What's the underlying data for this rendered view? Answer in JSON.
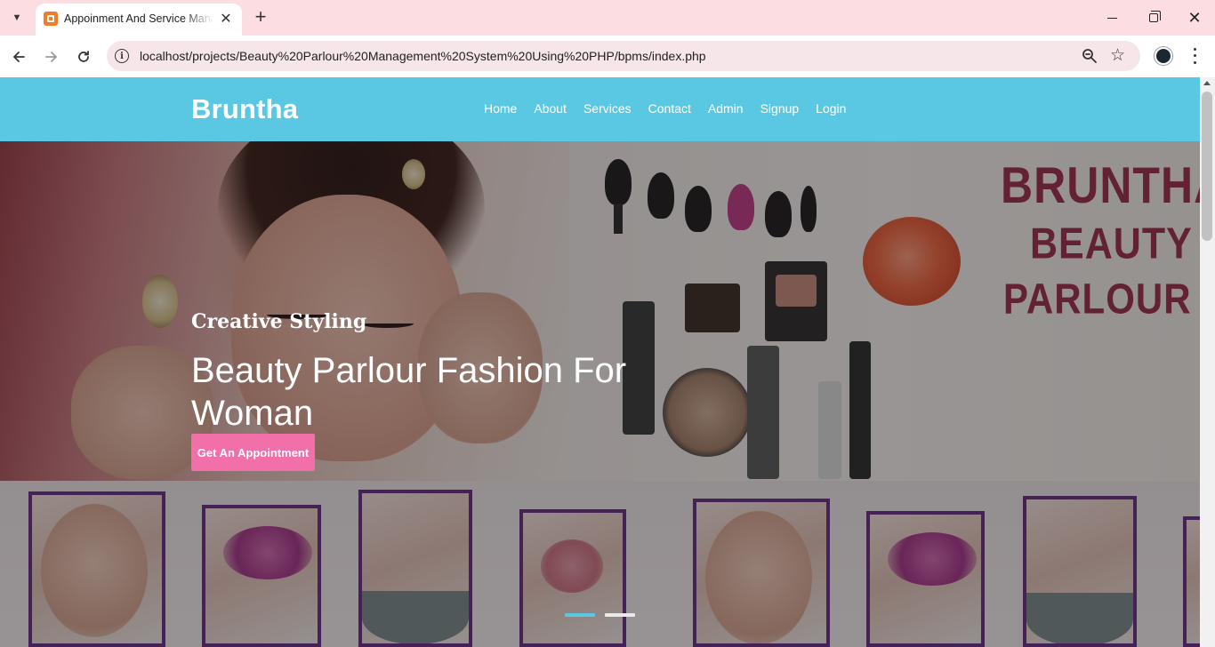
{
  "browser": {
    "tab_title": "Appoinment And Service Management",
    "url": "localhost/projects/Beauty%20Parlour%20Management%20System%20Using%20PHP/bpms/index.php",
    "icons": [
      "tab-list-icon",
      "favicon-icon",
      "close-icon",
      "plus-icon",
      "minimize-icon",
      "restore-icon",
      "window-close-icon",
      "back-icon",
      "forward-icon",
      "reload-icon",
      "info-icon",
      "zoom-icon",
      "star-icon",
      "profile-icon",
      "more-vert-icon"
    ]
  },
  "site": {
    "brand": "Bruntha",
    "nav": [
      "Home",
      "About",
      "Services",
      "Contact",
      "Admin",
      "Signup",
      "Login"
    ],
    "header_color": "#5bc8e3"
  },
  "hero": {
    "subtitle": "Creative Styling",
    "title": "Beauty Parlour Fashion For Woman",
    "cta_label": "Get An Appointment",
    "cta_color": "#f270a9",
    "poster_lines": [
      "BRUNTHA",
      "BEAUTY",
      "PARLOUR"
    ],
    "slides_total": 2,
    "active_slide": 1
  }
}
